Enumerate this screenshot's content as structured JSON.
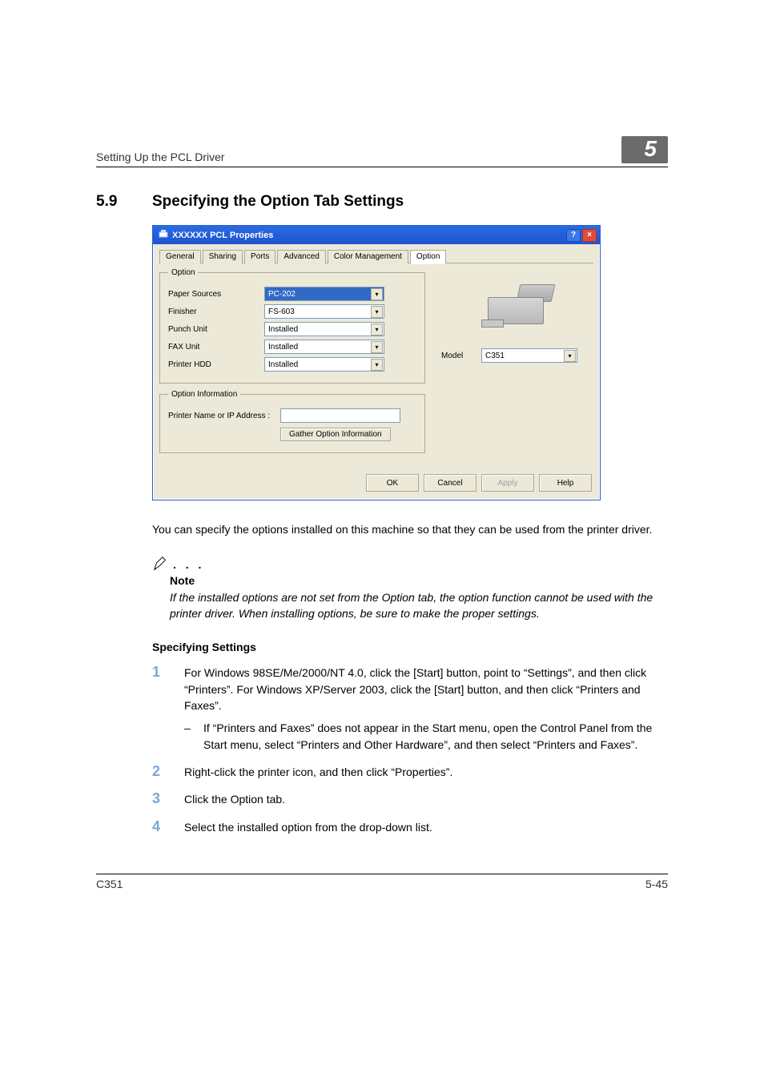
{
  "header": {
    "running": "Setting Up the PCL Driver",
    "chapter_badge": "5"
  },
  "section": {
    "number": "5.9",
    "title": "Specifying the Option Tab Settings"
  },
  "dialog": {
    "title": "XXXXXX PCL Properties",
    "help_glyph": "?",
    "close_glyph": "×",
    "tabs": {
      "general": "General",
      "sharing": "Sharing",
      "ports": "Ports",
      "advanced": "Advanced",
      "color": "Color Management",
      "option": "Option"
    },
    "option_group_legend": "Option",
    "rows": {
      "paper_sources": {
        "label": "Paper Sources",
        "value": "PC-202"
      },
      "finisher": {
        "label": "Finisher",
        "value": "FS-603"
      },
      "punch_unit": {
        "label": "Punch Unit",
        "value": "Installed"
      },
      "fax_unit": {
        "label": "FAX Unit",
        "value": "Installed"
      },
      "printer_hdd": {
        "label": "Printer HDD",
        "value": "Installed"
      }
    },
    "info_group_legend": "Option Information",
    "printer_name_label": "Printer Name or IP Address :",
    "gather_button": "Gather Option Information",
    "model_label": "Model",
    "model_value": "C351",
    "buttons": {
      "ok": "OK",
      "cancel": "Cancel",
      "apply": "Apply",
      "help": "Help"
    }
  },
  "body": {
    "para1": "You can specify the options installed on this machine so that they can be used from the printer driver.",
    "note_label": "Note",
    "note_text": "If the installed options are not set from the Option tab, the option function cannot be used with the printer driver. When installing options, be sure to make the proper settings.",
    "spec_settings": "Specifying Settings",
    "step1": "For Windows 98SE/Me/2000/NT 4.0, click the [Start] button, point to “Settings”, and then click “Printers”. For Windows XP/Server 2003, click the [Start] button, and then click “Printers and Faxes”.",
    "step1_sub": "If “Printers and Faxes” does not appear in the Start menu, open the Control Panel from the Start menu, select “Printers and Other Hardware”, and then select “Printers and Faxes”.",
    "step2": "Right-click the printer icon, and then click “Properties”.",
    "step3": "Click the Option tab.",
    "step4": "Select the installed option from the drop-down list.",
    "n1": "1",
    "n2": "2",
    "n3": "3",
    "n4": "4",
    "dash": "–"
  },
  "footer": {
    "left": "C351",
    "right": "5-45"
  }
}
